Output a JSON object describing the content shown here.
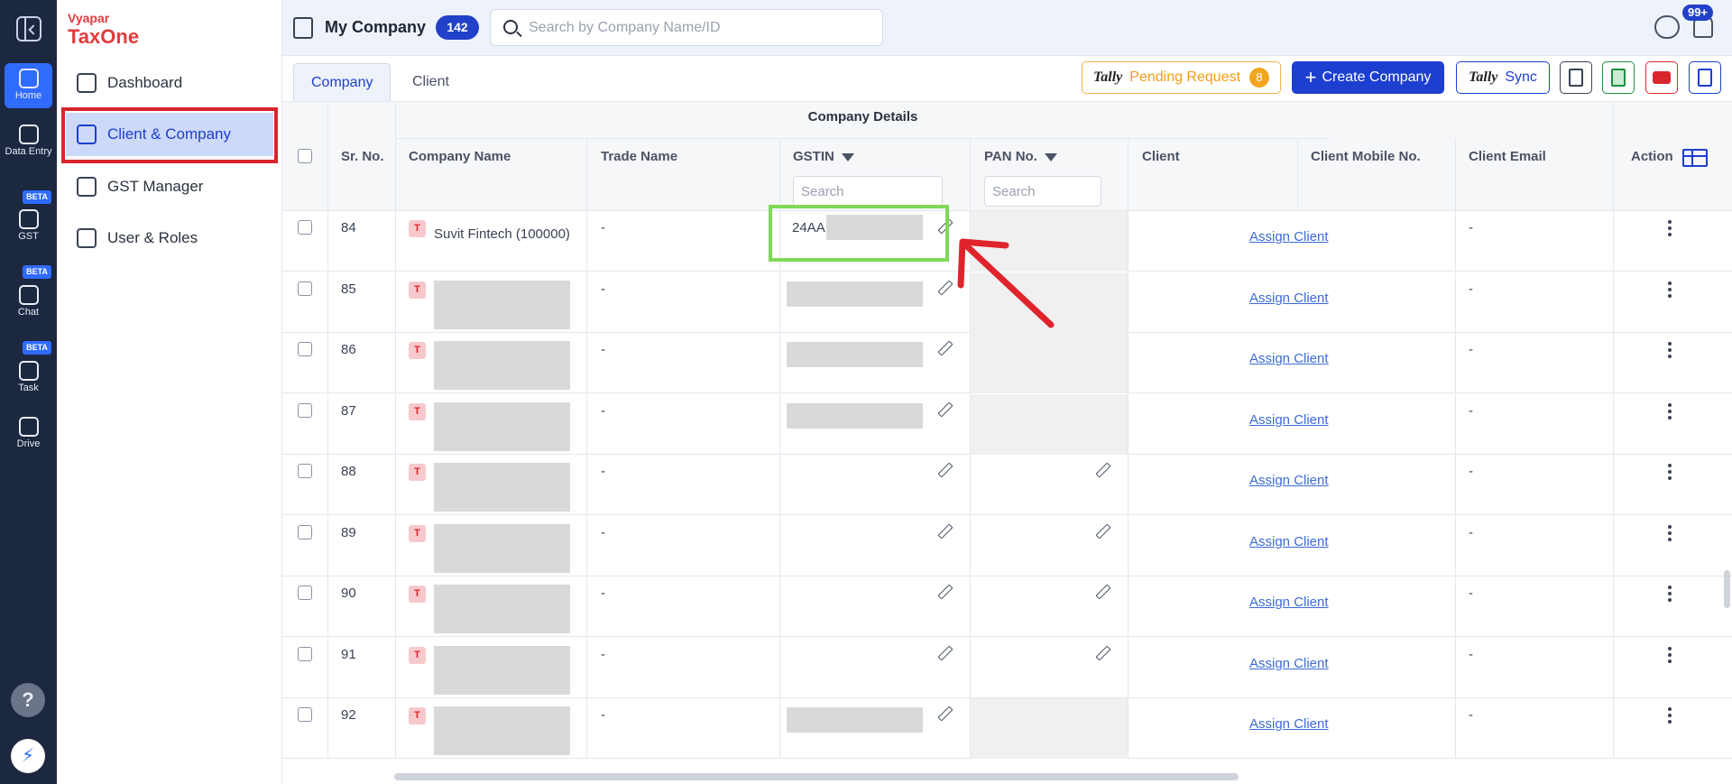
{
  "rail": {
    "items": [
      {
        "label": "Home",
        "active": true
      },
      {
        "label": "Data Entry",
        "active": false
      },
      {
        "label": "GST",
        "beta": "BETA"
      },
      {
        "label": "Chat",
        "beta": "BETA"
      },
      {
        "label": "Task",
        "beta": "BETA"
      },
      {
        "label": "Drive"
      }
    ],
    "help": "?"
  },
  "brand": {
    "line1": "Vyapar",
    "line2": "TaxOne"
  },
  "nav": {
    "items": [
      {
        "label": "Dashboard"
      },
      {
        "label": "Client & Company",
        "selected": true
      },
      {
        "label": "GST Manager"
      },
      {
        "label": "User & Roles"
      }
    ]
  },
  "topbar": {
    "title": "My Company",
    "count": "142",
    "search_placeholder": "Search by Company Name/ID",
    "notif_badge": "99+"
  },
  "tabs": {
    "items": [
      "Company",
      "Client"
    ],
    "active": "Company"
  },
  "actions": {
    "pending_brand": "Tally",
    "pending_label": "Pending Request",
    "pending_count": "8",
    "create_label": "Create Company",
    "sync_brand": "Tally",
    "sync_label": "Sync"
  },
  "grid": {
    "group_title": "Company Details",
    "columns": {
      "sr": "Sr. No.",
      "company": "Company Name",
      "trade": "Trade Name",
      "gstin": "GSTIN",
      "pan": "PAN No.",
      "client": "Client",
      "mobile": "Client Mobile No.",
      "email": "Client Email",
      "action": "Action"
    },
    "filter_placeholder": "Search"
  },
  "rows": [
    {
      "sr": "84",
      "badge": "T",
      "company": "Suvit Fintech (100000)",
      "trade": "-",
      "gstin": "24AA",
      "assign": "Assign Client",
      "email": "-"
    },
    {
      "sr": "85",
      "badge": "T",
      "trade": "-",
      "assign": "Assign Client",
      "email": "-"
    },
    {
      "sr": "86",
      "badge": "T",
      "trade": "-",
      "assign": "Assign Client",
      "email": "-"
    },
    {
      "sr": "87",
      "badge": "T",
      "trade": "-",
      "assign": "Assign Client",
      "email": "-"
    },
    {
      "sr": "88",
      "badge": "T",
      "trade": "-",
      "assign": "Assign Client",
      "email": "-"
    },
    {
      "sr": "89",
      "badge": "T",
      "trade": "-",
      "assign": "Assign Client",
      "email": "-"
    },
    {
      "sr": "90",
      "badge": "T",
      "trade": "-",
      "assign": "Assign Client",
      "email": "-"
    },
    {
      "sr": "91",
      "badge": "T",
      "trade": "-",
      "assign": "Assign Client",
      "email": "-"
    },
    {
      "sr": "92",
      "badge": "T",
      "trade": "-",
      "assign": "Assign Client",
      "email": "-"
    }
  ],
  "colors": {
    "accent": "#1d3fd0",
    "highlight_red": "#d9252e",
    "highlight_green": "#7ed957"
  }
}
